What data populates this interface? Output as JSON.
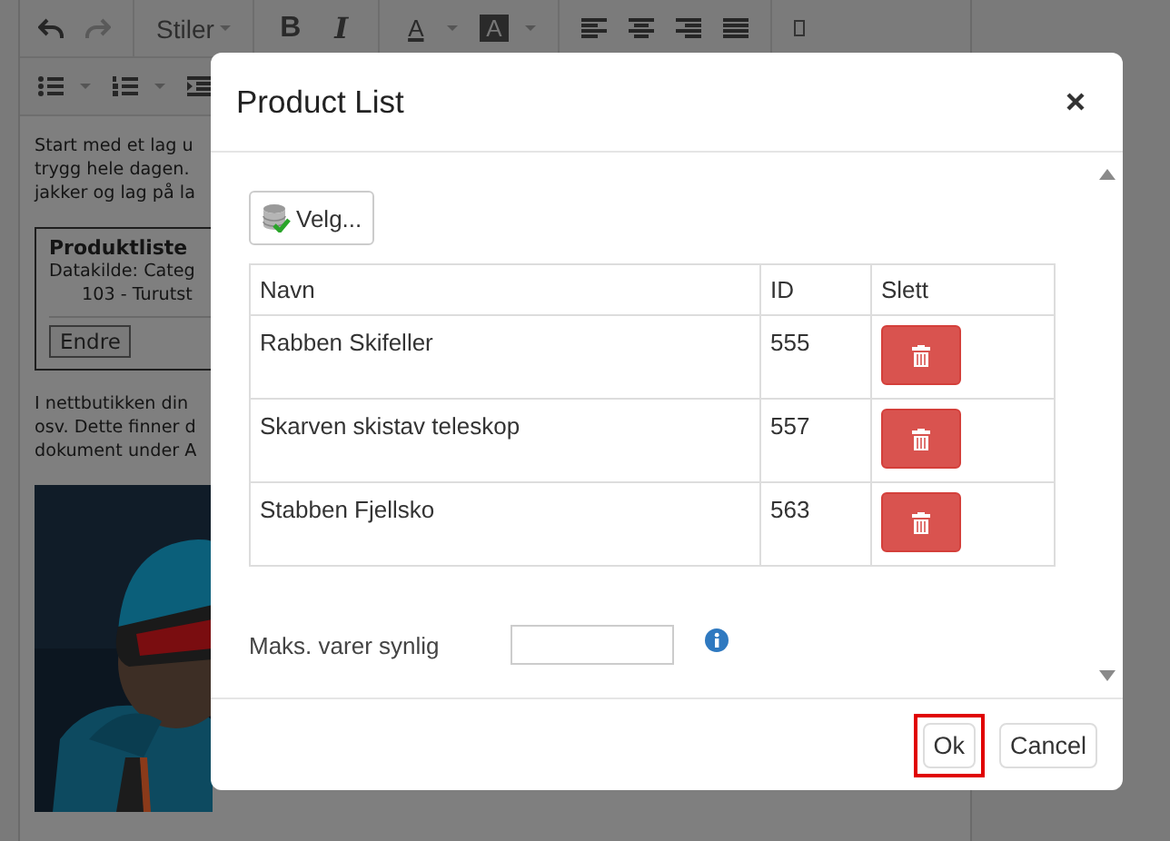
{
  "editor": {
    "toolbar": {
      "styles_label": "Stiler",
      "format_buttons": [
        {
          "label": "B",
          "kind": "bold"
        },
        {
          "label": "I",
          "kind": "italic"
        },
        {
          "label": "A",
          "kind": "text-color"
        },
        {
          "label": "A",
          "kind": "background-color"
        }
      ]
    },
    "intro_lines": [
      "Start med et lag u",
      "trygg hele dagen.",
      "jakker og lag på la"
    ],
    "product_box": {
      "title": "Produktliste",
      "lines": [
        "Datakilde: Categ",
        "103 - Turutst"
      ],
      "button": "Endre"
    },
    "body_lines": [
      "I nettbutikken din",
      "osv. Dette finner d",
      "dokument under A"
    ],
    "image": {
      "kind": "picture"
    }
  },
  "dialog": {
    "title": "Product List",
    "choose_button": "Velg...",
    "table": {
      "columns": [
        "Navn",
        "ID",
        "Slett"
      ],
      "rows": [
        {
          "name": "Rabben Skifeller",
          "id": "555"
        },
        {
          "name": "Skarven skistav teleskop",
          "id": "557"
        },
        {
          "name": "Stabben Fjellsko",
          "id": "563"
        }
      ]
    },
    "max_field": {
      "label": "Maks. varer synlig"
    },
    "buttons": [
      {
        "label": "Ok",
        "highlighted": true
      },
      {
        "label": "Cancel",
        "highlighted": false
      }
    ]
  }
}
